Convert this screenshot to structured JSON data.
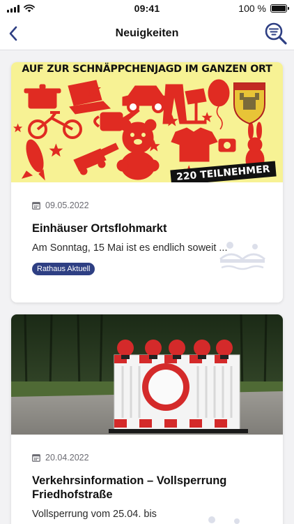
{
  "status_bar": {
    "time": "09:41",
    "battery_text": "100 %",
    "battery_level": 1.0
  },
  "nav": {
    "title": "Neuigkeiten",
    "back_icon": "chevron-left-icon",
    "search_icon": "search-filter-icon"
  },
  "colors": {
    "accent": "#2e3f83",
    "flyer_bg": "#f7f294",
    "flyer_red": "#e02b22",
    "road_red": "#d42a2a"
  },
  "news": [
    {
      "image_alt": "Flohmarkt-Flyer",
      "flyer_title": "AUF ZUR SCHNÄPPCHENJAGD IM GANZEN ORT",
      "flyer_banner": "220 TEILNEHMER",
      "date": "09.05.2022",
      "title": "Einhäuser Ortsflohmarkt",
      "excerpt": "Am Sonntag, 15 Mai ist es endlich soweit ...",
      "tag": "Rathaus Aktuell"
    },
    {
      "image_alt": "Straßensperre",
      "date": "20.04.2022",
      "title": "Verkehrsinformation – Vollsperrung Friedhofstraße",
      "excerpt": "Vollsperrung vom 25.04. bis"
    }
  ]
}
